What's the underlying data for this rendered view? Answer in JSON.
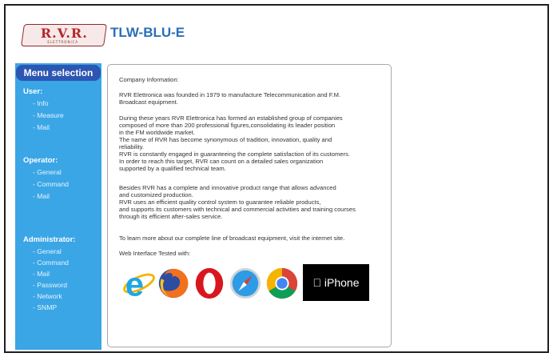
{
  "header": {
    "logo_text": "R.V.R.",
    "logo_sub": "ELETTRONICA",
    "title": "TLW-BLU-E"
  },
  "menu": {
    "title": "Menu selection",
    "sections": [
      {
        "label": "User:",
        "items": [
          "- Info",
          "- Measure",
          "- Mail"
        ]
      },
      {
        "label": "Operator:",
        "items": [
          "- General",
          "- Command",
          "- Mail"
        ]
      },
      {
        "label": "Administrator:",
        "items": [
          "- General",
          "- Command",
          "- Mail",
          "- Password",
          "- Network",
          "- SNMP"
        ]
      }
    ]
  },
  "content": {
    "heading": "Company Information:",
    "p1": [
      "RVR Elettronica was founded in 1979 to manufacture Telecommunication and F.M.",
      "Broadcast equipment."
    ],
    "p2": [
      "During these years RVR Elettronica has formed an established group of companies",
      "composed of more than 200 professional figures,consolidating its leader position",
      "in the FM worldwide market.",
      "The name of RVR has become synonymous of tradition, innovation, quality and",
      "reliability.",
      "RVR is constantly engaged in guaranteeing the complete satisfaction of its customers.",
      "In order to reach this target, RVR can count on a detailed sales organization",
      "supported by a qualified technical team."
    ],
    "p3": [
      "Besides RVR has a complete and innovative product range that allows advanced",
      "and customized production.",
      "RVR uses an efficient quality control system to guarantee reliable products,",
      "and supports its customers with technical and commercial activities and training courses",
      "through its efficient after-sales service."
    ],
    "p4": [
      "To learn more about our complete line of broadcast equipment, visit the internet site."
    ],
    "tested": "Web Interface Tested with:",
    "iphone_label": "iPhone",
    "browser_icons": [
      "internet-explorer-icon",
      "firefox-icon",
      "opera-icon",
      "safari-icon",
      "chrome-icon"
    ]
  }
}
